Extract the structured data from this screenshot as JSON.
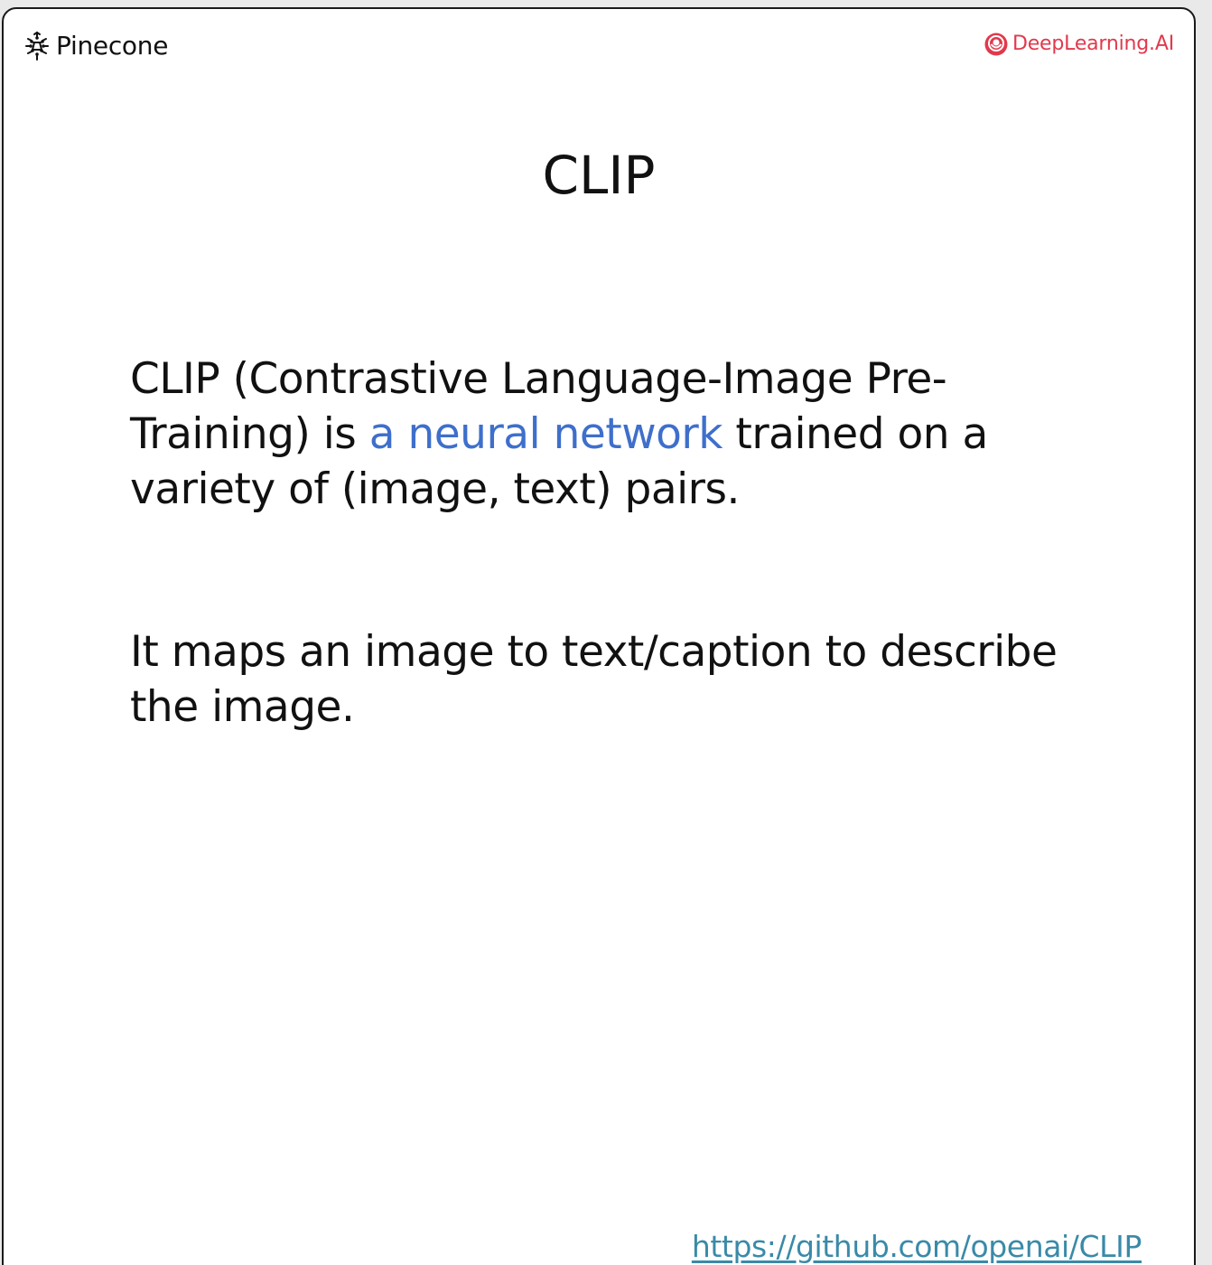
{
  "header": {
    "left_brand": "Pinecone",
    "right_brand": "DeepLearning.AI"
  },
  "slide": {
    "title": "CLIP",
    "paragraph_1": {
      "before": "CLIP (Contrastive Language-Image Pre-Training) is ",
      "highlight": "a neural network",
      "after": " trained on a variety of (image, text) pairs."
    },
    "paragraph_2": "It maps an image to text/caption to describe the image.",
    "link": "https://github.com/openai/CLIP"
  },
  "colors": {
    "highlight": "#3e6fcb",
    "link": "#3a8aa8",
    "deeplearning_brand": "#e1394c"
  },
  "icons": {
    "left_logo": "pinecone-logo-icon",
    "right_logo": "deeplearning-ai-logo-icon"
  }
}
